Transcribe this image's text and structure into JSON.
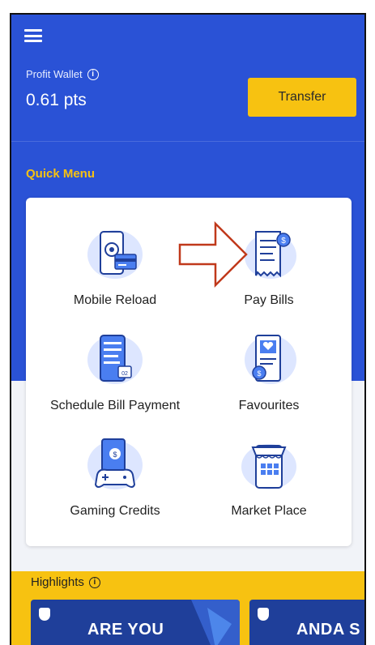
{
  "header": {
    "menu_icon": "hamburger-icon"
  },
  "wallet": {
    "label": "Profit Wallet",
    "value": "0.61 pts",
    "info_icon": "info-icon"
  },
  "transfer": {
    "label": "Transfer"
  },
  "quick_menu": {
    "title": "Quick Menu",
    "items": [
      {
        "label": "Mobile Reload",
        "icon": "mobile-reload-icon"
      },
      {
        "label": "Pay Bills",
        "icon": "pay-bills-icon"
      },
      {
        "label": "Schedule Bill Payment",
        "icon": "schedule-bill-icon"
      },
      {
        "label": "Favourites",
        "icon": "favourites-icon"
      },
      {
        "label": "Gaming Credits",
        "icon": "gaming-credits-icon"
      },
      {
        "label": "Market Place",
        "icon": "market-place-icon"
      }
    ]
  },
  "highlights": {
    "title": "Highlights",
    "banners": [
      {
        "text": "ARE YOU"
      },
      {
        "text": "ANDA S"
      }
    ]
  },
  "colors": {
    "primary_blue": "#2a52d6",
    "accent_yellow": "#f7c211",
    "annotation_red": "#c0391b"
  }
}
